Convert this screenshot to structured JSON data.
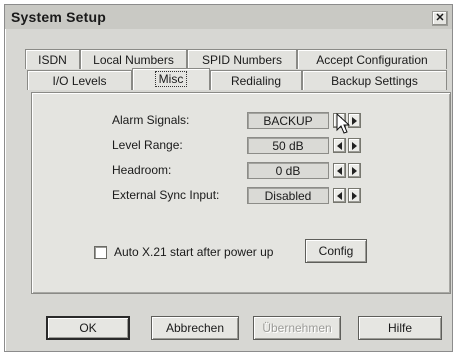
{
  "window": {
    "title": "System Setup",
    "close_glyph": "✕"
  },
  "tabs": {
    "row1": [
      "ISDN",
      "Local Numbers",
      "SPID Numbers",
      "Accept Configuration"
    ],
    "row2": [
      "I/O Levels",
      "Misc",
      "Redialing",
      "Backup Settings"
    ],
    "active": "Misc"
  },
  "settings": [
    {
      "label": "Alarm Signals:",
      "value": "BACKUP"
    },
    {
      "label": "Level Range:",
      "value": "50 dB"
    },
    {
      "label": "Headroom:",
      "value": "0 dB"
    },
    {
      "label": "External Sync Input:",
      "value": "Disabled"
    }
  ],
  "autostart": {
    "label": "Auto X.21 start after power up",
    "checked": false,
    "config_button": "Config"
  },
  "buttons": {
    "ok": "OK",
    "cancel": "Abbrechen",
    "apply": "Übernehmen",
    "help": "Hilfe"
  },
  "icons": {
    "spin_left": "arrow-left-icon",
    "spin_right": "arrow-right-icon",
    "cursor": "mouse-pointer-icon"
  }
}
